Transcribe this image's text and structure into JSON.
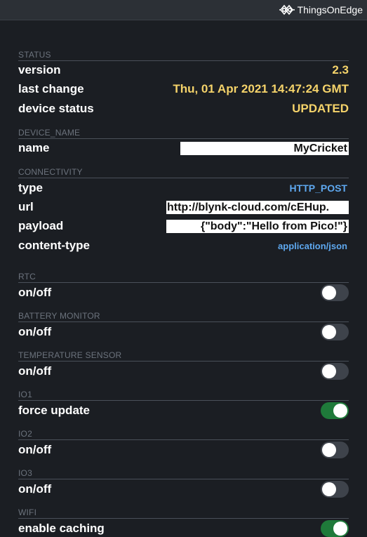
{
  "brand": {
    "name": "ThingsOnEdge"
  },
  "status": {
    "title": "STATUS",
    "version_label": "version",
    "version_value": "2.3",
    "last_change_label": "last change",
    "last_change_value": "Thu, 01 Apr 2021 14:47:24 GMT",
    "device_status_label": "device status",
    "device_status_value": "UPDATED"
  },
  "device_name": {
    "title": "DEVICE_NAME",
    "name_label": "name",
    "name_value": "MyCricket"
  },
  "connectivity": {
    "title": "CONNECTIVITY",
    "type_label": "type",
    "type_value": "HTTP_POST",
    "url_label": "url",
    "url_value": "http://blynk-cloud.com/cEHup.",
    "payload_label": "payload",
    "payload_value": "{\"body\":\"Hello from Pico!\"}",
    "content_type_label": "content-type",
    "content_type_value": "application/json"
  },
  "toggles": [
    {
      "section": "RTC",
      "label": "on/off",
      "on": false
    },
    {
      "section": "BATTERY MONITOR",
      "label": "on/off",
      "on": false
    },
    {
      "section": "TEMPERATURE SENSOR",
      "label": "on/off",
      "on": false
    },
    {
      "section": "IO1",
      "label": "force update",
      "on": true
    },
    {
      "section": "IO2",
      "label": "on/off",
      "on": false
    },
    {
      "section": "IO3",
      "label": "on/off",
      "on": false
    },
    {
      "section": "WIFI",
      "label": "enable caching",
      "on": true
    }
  ],
  "colors": {
    "background": "#1b1e23",
    "accent_yellow": "#f5d36a",
    "accent_blue": "#5ea8ef",
    "toggle_on": "#1f7a3a",
    "toggle_off": "#3e434b"
  }
}
